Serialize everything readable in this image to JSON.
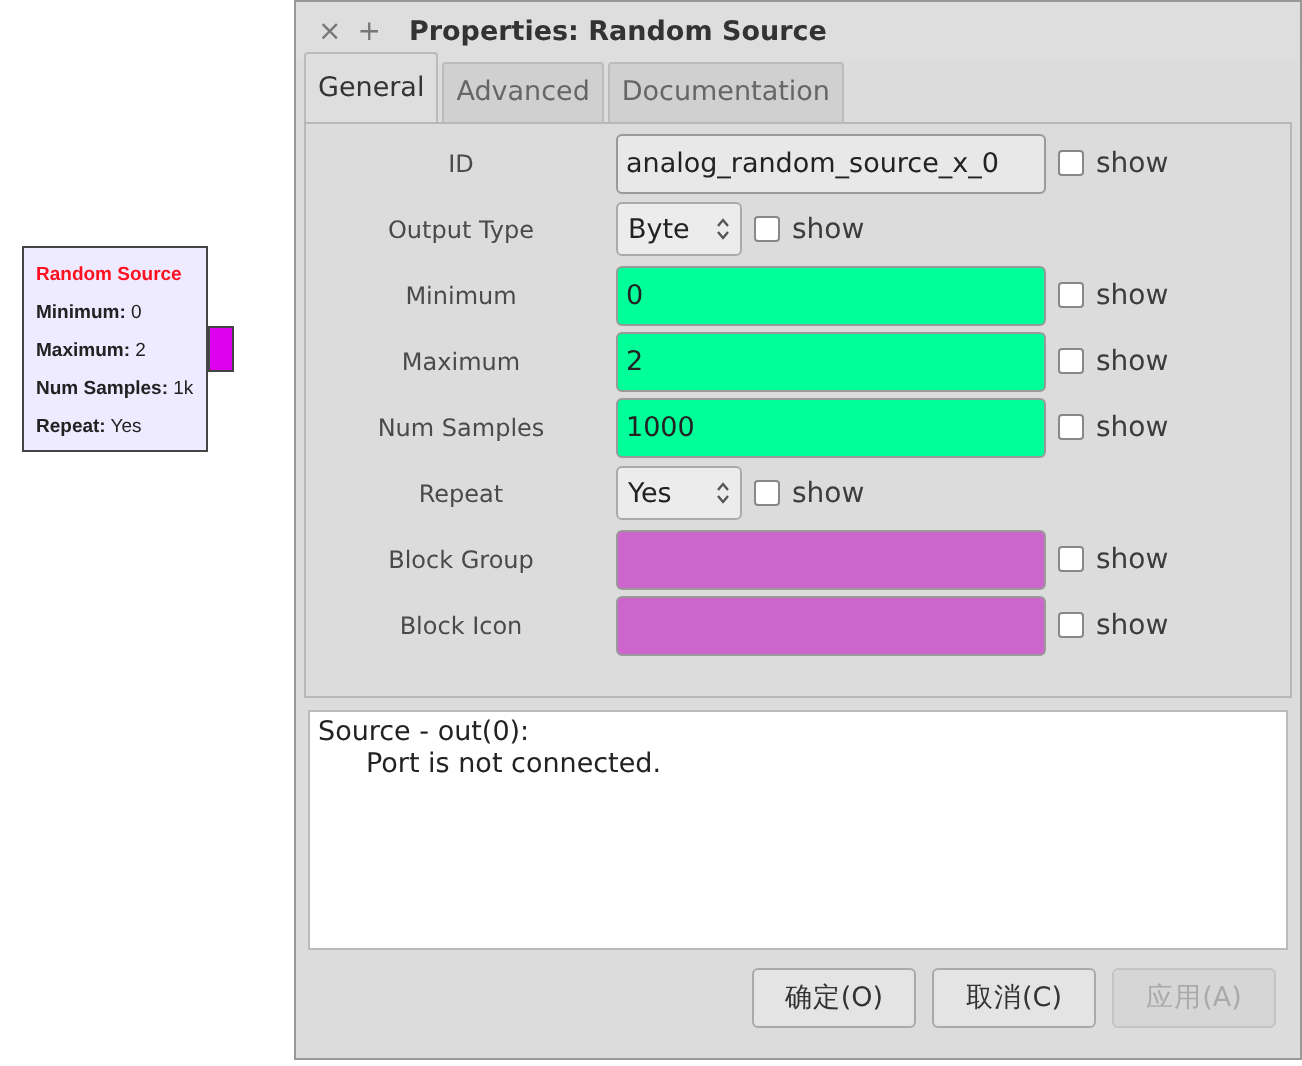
{
  "block": {
    "title": "Random Source",
    "params": [
      {
        "name": "Minimum:",
        "value": "0"
      },
      {
        "name": "Maximum:",
        "value": "2"
      },
      {
        "name": "Num Samples:",
        "value": "1k"
      },
      {
        "name": "Repeat:",
        "value": "Yes"
      }
    ]
  },
  "window": {
    "close": "×",
    "add": "+",
    "title": "Properties: Random Source"
  },
  "tabs": [
    {
      "label": "General",
      "selected": true
    },
    {
      "label": "Advanced",
      "selected": false
    },
    {
      "label": "Documentation",
      "selected": false
    }
  ],
  "params": [
    {
      "kind": "text",
      "label": "ID",
      "value": "analog_random_source_x_0",
      "color": "#e8e8e8",
      "show": false,
      "show_label": "show"
    },
    {
      "kind": "combo",
      "label": "Output Type",
      "value": "Byte",
      "show": false,
      "show_label": "show"
    },
    {
      "kind": "text",
      "label": "Minimum",
      "value": "0",
      "color": "#00ff99",
      "show": false,
      "show_label": "show"
    },
    {
      "kind": "text",
      "label": "Maximum",
      "value": "2",
      "color": "#00ff99",
      "show": false,
      "show_label": "show"
    },
    {
      "kind": "text",
      "label": "Num Samples",
      "value": "1000",
      "color": "#00ff99",
      "show": false,
      "show_label": "show"
    },
    {
      "kind": "combo",
      "label": "Repeat",
      "value": "Yes",
      "show": false,
      "show_label": "show"
    },
    {
      "kind": "text",
      "label": "Block Group",
      "color": "#cc66cc",
      "show": false,
      "show_label": "show"
    },
    {
      "kind": "text",
      "label": "Block Icon",
      "color": "#cc66cc",
      "show": false,
      "show_label": "show"
    }
  ],
  "messages": {
    "heading": "Source - out(0):",
    "body": "Port is not connected."
  },
  "buttons": [
    {
      "label": "确定(O)",
      "disabled": false
    },
    {
      "label": "取消(C)",
      "disabled": false
    },
    {
      "label": "应用(A)",
      "disabled": true
    }
  ]
}
